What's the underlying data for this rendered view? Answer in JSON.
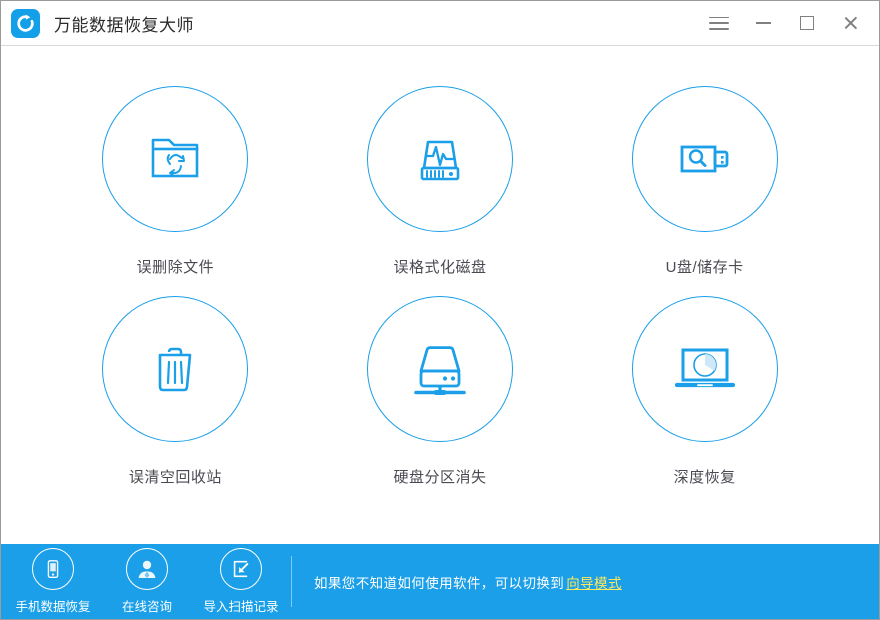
{
  "window": {
    "title": "万能数据恢复大师",
    "logo_icon": "refresh-circle-logo",
    "controls": [
      {
        "name": "menu",
        "icon": "hamburger-menu-icon"
      },
      {
        "name": "minimize",
        "icon": "minimize-icon"
      },
      {
        "name": "maximize",
        "icon": "maximize-icon"
      },
      {
        "name": "close",
        "icon": "close-icon"
      }
    ]
  },
  "colors": {
    "accent": "#1a9fe8",
    "footer_background": "#1a9fe8",
    "label_text": "#4a4a52",
    "link": "#ffe95c",
    "window_border": "#9b9b9b"
  },
  "main": {
    "features": [
      {
        "id": "deleted-files",
        "label": "误删除文件",
        "icon": "folder-recycle-icon"
      },
      {
        "id": "formatted-disk",
        "label": "误格式化磁盘",
        "icon": "disk-pulse-icon"
      },
      {
        "id": "usb-memory-card",
        "label": "U盘/储存卡",
        "icon": "usb-search-icon"
      },
      {
        "id": "emptied-recyclebin",
        "label": "误清空回收站",
        "icon": "trash-bin-icon"
      },
      {
        "id": "lost-partition",
        "label": "硬盘分区消失",
        "icon": "hard-drive-icon"
      },
      {
        "id": "deep-recovery",
        "label": "深度恢复",
        "icon": "laptop-pie-icon"
      }
    ]
  },
  "footer": {
    "actions": [
      {
        "id": "phone-data-recovery",
        "label": "手机数据恢复",
        "icon": "mobile-phone-icon"
      },
      {
        "id": "online-consult",
        "label": "在线咨询",
        "icon": "person-support-icon"
      },
      {
        "id": "import-scan-record",
        "label": "导入扫描记录",
        "icon": "import-arrow-icon"
      }
    ],
    "hint_prefix": "如果您不知道如何使用软件，可以切换到",
    "hint_link": "向导模式"
  }
}
